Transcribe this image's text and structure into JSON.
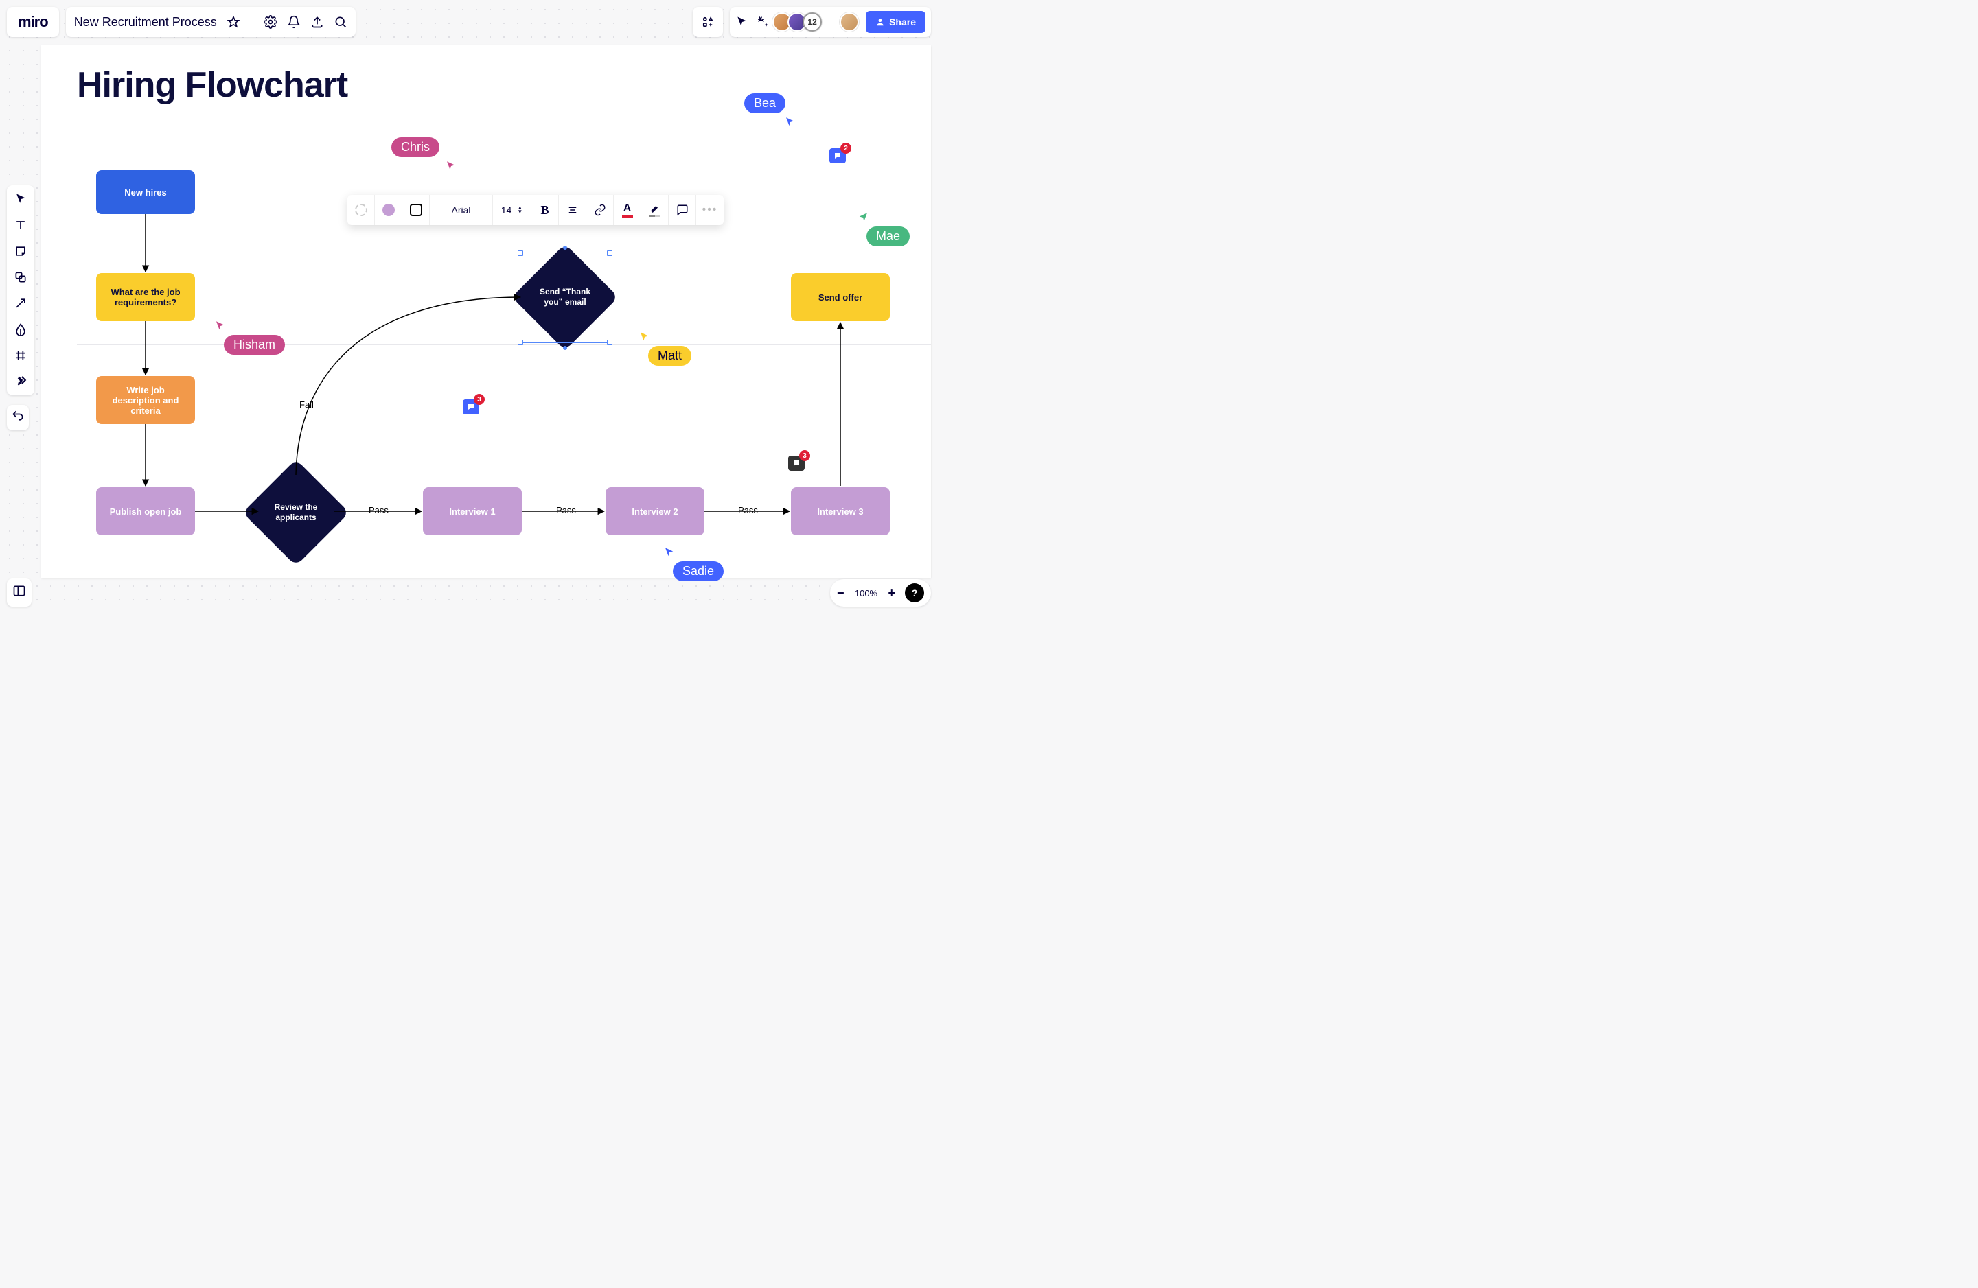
{
  "app": {
    "logo": "miro",
    "board_name": "New Recruitment Process"
  },
  "topbar": {
    "icons": [
      "star-icon",
      "settings-icon",
      "bell-icon",
      "export-icon",
      "search-icon"
    ],
    "apps_icon": "apps-icon"
  },
  "topright": {
    "cursor_tool": "cursor",
    "reactions": "reactions",
    "more_count": "12",
    "share_label": "Share"
  },
  "left_tools": [
    "select",
    "text",
    "sticky",
    "shape",
    "arrow",
    "pen",
    "frame-tool",
    "more"
  ],
  "canvas": {
    "title": "Hiring Flowchart",
    "nodes": {
      "new_hires": "New hires",
      "requirements": "What are the job requirements?",
      "write_desc": "Write job description and criteria",
      "publish": "Publish open job",
      "review": "Review the applicants",
      "interview1": "Interview 1",
      "interview2": "Interview 2",
      "interview3": "Interview 3",
      "thank_you": "Send “Thank you” email",
      "send_offer": "Send offer"
    },
    "edges": {
      "pass": "Pass",
      "fail": "Fail"
    }
  },
  "context_toolbar": {
    "font": "Arial",
    "size": "14"
  },
  "cursors": {
    "chris": {
      "name": "Chris",
      "color": "#C84A8A"
    },
    "hisham": {
      "name": "Hisham",
      "color": "#C84A8A"
    },
    "bea": {
      "name": "Bea",
      "color": "#4262FF"
    },
    "mae": {
      "name": "Mae",
      "color": "#47B880"
    },
    "matt": {
      "name": "Matt",
      "color": "#FACD2C",
      "text": "#050038"
    },
    "sadie": {
      "name": "Sadie",
      "color": "#4262FF"
    }
  },
  "comments": {
    "c1": {
      "count": "3",
      "color": "#4262FF"
    },
    "c2": {
      "count": "2",
      "color": "#4262FF"
    },
    "c3": {
      "count": "3",
      "color": "#333"
    }
  },
  "zoom": {
    "level": "100%"
  },
  "avatars": {
    "a1": "#E2A56B",
    "a2": "#7B5CC6",
    "a3": "#B0B0B0",
    "a4": "#E2B98A"
  }
}
